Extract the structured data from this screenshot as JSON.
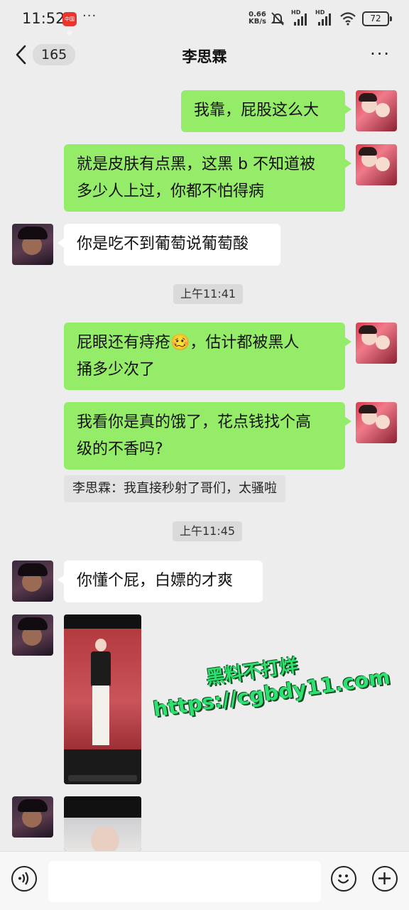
{
  "status_bar": {
    "time": "11:52",
    "app_badge": "中国移",
    "net_speed_value": "0.66",
    "net_speed_unit": "KB/s",
    "signal_label": "HD",
    "battery": "72"
  },
  "header": {
    "unread_count": "165",
    "title": "李思霖"
  },
  "messages": [
    {
      "side": "right",
      "text": "我靠，屁股这么大"
    },
    {
      "side": "right",
      "text_line1": "就是皮肤有点黑，这黑 b 不知道被",
      "text_line2": "多少人上过，你都不怕得病"
    },
    {
      "side": "left",
      "text": "你是吃不到葡萄说葡萄酸"
    },
    {
      "type": "timestamp",
      "text": "上午11:41"
    },
    {
      "side": "right",
      "text_line1a": "屁眼还有痔疮",
      "emoji": "🥴",
      "text_line1b": "，估计都被黑人",
      "text_line2": "捅多少次了"
    },
    {
      "side": "right",
      "text_line1": "我看你是真的饿了，花点钱找个高",
      "text_line2": "级的不香吗?"
    },
    {
      "type": "quote",
      "text": "李思霖：我直接秒射了哥们，太骚啦"
    },
    {
      "type": "timestamp",
      "text": "上午11:45"
    },
    {
      "side": "left",
      "text": "你懂个屁，白嫖的才爽"
    }
  ],
  "watermark": {
    "line1": "黑料不打烊",
    "line2": "https://cgbdy11.com"
  },
  "input_bar": {
    "placeholder": ""
  },
  "colors": {
    "green_bubble": "#95ec69",
    "background": "#ededed",
    "watermark": "#2ee06f"
  }
}
